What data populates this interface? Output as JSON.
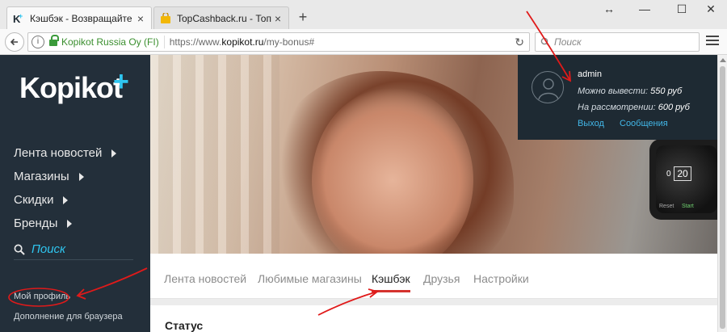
{
  "browser": {
    "tabs": [
      {
        "title": "Кэшбэк - Возвращайте д...",
        "active": true
      },
      {
        "title": "TopCashback.ru - Топ лу...",
        "active": false
      }
    ],
    "close_glyph": "×",
    "new_tab_glyph": "+",
    "window_controls": {
      "resize": "↔",
      "minimize": "—",
      "maximize": "☐",
      "close": "✕"
    },
    "address": {
      "owner": "Kopikot Russia Oy (FI)",
      "url_prefix": "https://www.",
      "url_domain": "kopikot.ru",
      "url_path": "/my-bonus#"
    },
    "search_placeholder": "Поиск",
    "colors": {
      "secure": "#3a8f2e"
    }
  },
  "site": {
    "logo": "Kopikot",
    "logo_plus": "+",
    "colors": {
      "accent": "#2fc6f0",
      "sidebar_bg": "#232f3a",
      "active_tab_underline": "#d5332e",
      "annotation": "#e01a1a"
    },
    "sidebar": {
      "items": [
        {
          "label": "Лента новостей"
        },
        {
          "label": "Магазины"
        },
        {
          "label": "Скидки"
        },
        {
          "label": "Бренды"
        }
      ],
      "search_label": "Поиск",
      "my_profile": "Мой профиль",
      "browser_addon": "Дополнение для браузера"
    },
    "user": {
      "name": "admin",
      "withdraw_label": "Можно вывести:",
      "withdraw_value": "550 руб",
      "pending_label": "На рассмотрении:",
      "pending_value": "600 руб",
      "logout": "Выход",
      "messages": "Сообщения"
    },
    "hero_watch": {
      "time": "20",
      "digit_left": "0",
      "reset": "Reset",
      "start": "Start"
    },
    "profile_tabs": [
      {
        "label": "Лента новостей",
        "active": false
      },
      {
        "label": "Любимые магазины",
        "active": false
      },
      {
        "label": "Кэшбэк",
        "active": true
      },
      {
        "label": "Друзья",
        "active": false
      },
      {
        "label": "Настройки",
        "active": false
      }
    ],
    "status_title": "Статус"
  }
}
